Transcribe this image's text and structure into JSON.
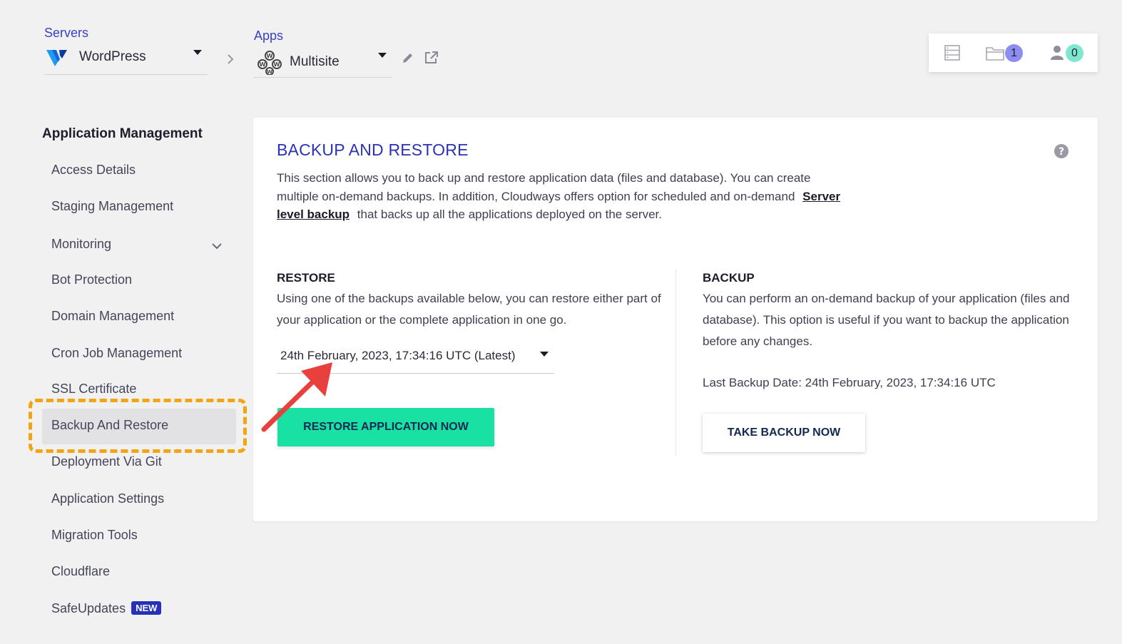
{
  "header": {
    "servers_label": "Servers",
    "server_name": "WordPress",
    "apps_label": "Apps",
    "app_name": "Multisite"
  },
  "toolbar": {
    "projects_count": "1",
    "team_count": "0"
  },
  "sidebar": {
    "title": "Application Management",
    "items": [
      {
        "label": "Access Details"
      },
      {
        "label": "Staging Management"
      },
      {
        "label": "Monitoring"
      },
      {
        "label": "Bot Protection"
      },
      {
        "label": "Domain Management"
      },
      {
        "label": "Cron Job Management"
      },
      {
        "label": "SSL Certificate"
      },
      {
        "label": "Backup And Restore"
      },
      {
        "label": "Deployment Via Git"
      },
      {
        "label": "Application Settings"
      },
      {
        "label": "Migration Tools"
      },
      {
        "label": "Cloudflare"
      },
      {
        "label": "SafeUpdates",
        "badge": "NEW"
      }
    ],
    "active_item": "Backup And Restore"
  },
  "main": {
    "title": "BACKUP AND RESTORE",
    "description_part1": "This section allows you to back up and restore application data (files and database). You can create multiple on-demand backups. In addition, Cloudways offers option for scheduled and on-demand",
    "description_link": "Server level backup",
    "description_part2": "that backs up all the applications deployed on the server.",
    "restore": {
      "heading": "RESTORE",
      "text": "Using one of the backups available below, you can restore either part of your application or the complete application in one go.",
      "selected_backup": "24th February, 2023, 17:34:16 UTC (Latest)",
      "button": "RESTORE APPLICATION NOW"
    },
    "backup": {
      "heading": "BACKUP",
      "text": "You can perform an on-demand backup of your application (files and database). This option is useful if you want to backup the application before any changes.",
      "last_backup": "Last Backup Date: 24th February, 2023, 17:34:16 UTC",
      "button": "TAKE BACKUP NOW"
    }
  },
  "colors": {
    "accent_blue": "#2b33b5",
    "restore_green": "#19e1a4",
    "highlight_orange": "#f2a413",
    "annotation_red": "#e8403c",
    "badge_purple": "#8b8ef0",
    "badge_teal": "#7de8cf"
  }
}
